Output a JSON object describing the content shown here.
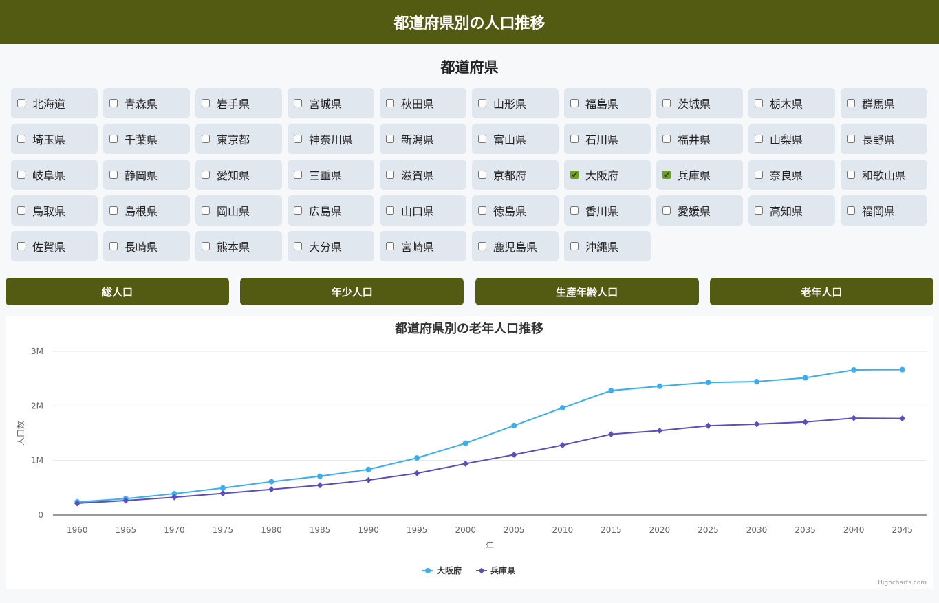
{
  "header": {
    "title": "都道府県別の人口推移"
  },
  "prefecture_section": {
    "title": "都道府県"
  },
  "prefectures": [
    {
      "name": "北海道",
      "checked": false
    },
    {
      "name": "青森県",
      "checked": false
    },
    {
      "name": "岩手県",
      "checked": false
    },
    {
      "name": "宮城県",
      "checked": false
    },
    {
      "name": "秋田県",
      "checked": false
    },
    {
      "name": "山形県",
      "checked": false
    },
    {
      "name": "福島県",
      "checked": false
    },
    {
      "name": "茨城県",
      "checked": false
    },
    {
      "name": "栃木県",
      "checked": false
    },
    {
      "name": "群馬県",
      "checked": false
    },
    {
      "name": "埼玉県",
      "checked": false
    },
    {
      "name": "千葉県",
      "checked": false
    },
    {
      "name": "東京都",
      "checked": false
    },
    {
      "name": "神奈川県",
      "checked": false
    },
    {
      "name": "新潟県",
      "checked": false
    },
    {
      "name": "富山県",
      "checked": false
    },
    {
      "name": "石川県",
      "checked": false
    },
    {
      "name": "福井県",
      "checked": false
    },
    {
      "name": "山梨県",
      "checked": false
    },
    {
      "name": "長野県",
      "checked": false
    },
    {
      "name": "岐阜県",
      "checked": false
    },
    {
      "name": "静岡県",
      "checked": false
    },
    {
      "name": "愛知県",
      "checked": false
    },
    {
      "name": "三重県",
      "checked": false
    },
    {
      "name": "滋賀県",
      "checked": false
    },
    {
      "name": "京都府",
      "checked": false
    },
    {
      "name": "大阪府",
      "checked": true
    },
    {
      "name": "兵庫県",
      "checked": true
    },
    {
      "name": "奈良県",
      "checked": false
    },
    {
      "name": "和歌山県",
      "checked": false
    },
    {
      "name": "鳥取県",
      "checked": false
    },
    {
      "name": "島根県",
      "checked": false
    },
    {
      "name": "岡山県",
      "checked": false
    },
    {
      "name": "広島県",
      "checked": false
    },
    {
      "name": "山口県",
      "checked": false
    },
    {
      "name": "徳島県",
      "checked": false
    },
    {
      "name": "香川県",
      "checked": false
    },
    {
      "name": "愛媛県",
      "checked": false
    },
    {
      "name": "高知県",
      "checked": false
    },
    {
      "name": "福岡県",
      "checked": false
    },
    {
      "name": "佐賀県",
      "checked": false
    },
    {
      "name": "長崎県",
      "checked": false
    },
    {
      "name": "熊本県",
      "checked": false
    },
    {
      "name": "大分県",
      "checked": false
    },
    {
      "name": "宮崎県",
      "checked": false
    },
    {
      "name": "鹿児島県",
      "checked": false
    },
    {
      "name": "沖縄県",
      "checked": false
    }
  ],
  "category_buttons": [
    "総人口",
    "年少人口",
    "生産年齢人口",
    "老年人口"
  ],
  "colors": {
    "header_bg": "#535b12",
    "osaka": "#3aaeef",
    "hyogo": "#5b4dbe",
    "checked": "#6aa613"
  },
  "chart_data": {
    "type": "line",
    "title": "都道府県別の老年人口推移",
    "xlabel": "年",
    "ylabel": "人口数",
    "ylim": [
      0,
      3000000
    ],
    "y_ticks": [
      0,
      1000000,
      2000000,
      3000000
    ],
    "y_tick_labels": [
      "0",
      "1M",
      "2M",
      "3M"
    ],
    "x": [
      1960,
      1965,
      1970,
      1975,
      1980,
      1985,
      1990,
      1995,
      2000,
      2005,
      2010,
      2015,
      2020,
      2025,
      2030,
      2035,
      2040,
      2045
    ],
    "series": [
      {
        "name": "大阪府",
        "color": "#3aaeef",
        "marker": "circle",
        "values": [
          240000,
          300000,
          390000,
          495000,
          610000,
          710000,
          835000,
          1045000,
          1315000,
          1640000,
          1965000,
          2280000,
          2360000,
          2430000,
          2445000,
          2515000,
          2660000,
          2665000
        ]
      },
      {
        "name": "兵庫県",
        "color": "#5b4dbe",
        "marker": "diamond",
        "values": [
          215000,
          265000,
          325000,
          395000,
          470000,
          545000,
          640000,
          765000,
          940000,
          1105000,
          1280000,
          1480000,
          1545000,
          1635000,
          1665000,
          1705000,
          1775000,
          1770000
        ]
      }
    ],
    "legend": "bottom-center",
    "grid": true,
    "credit": "Highcharts.com"
  }
}
